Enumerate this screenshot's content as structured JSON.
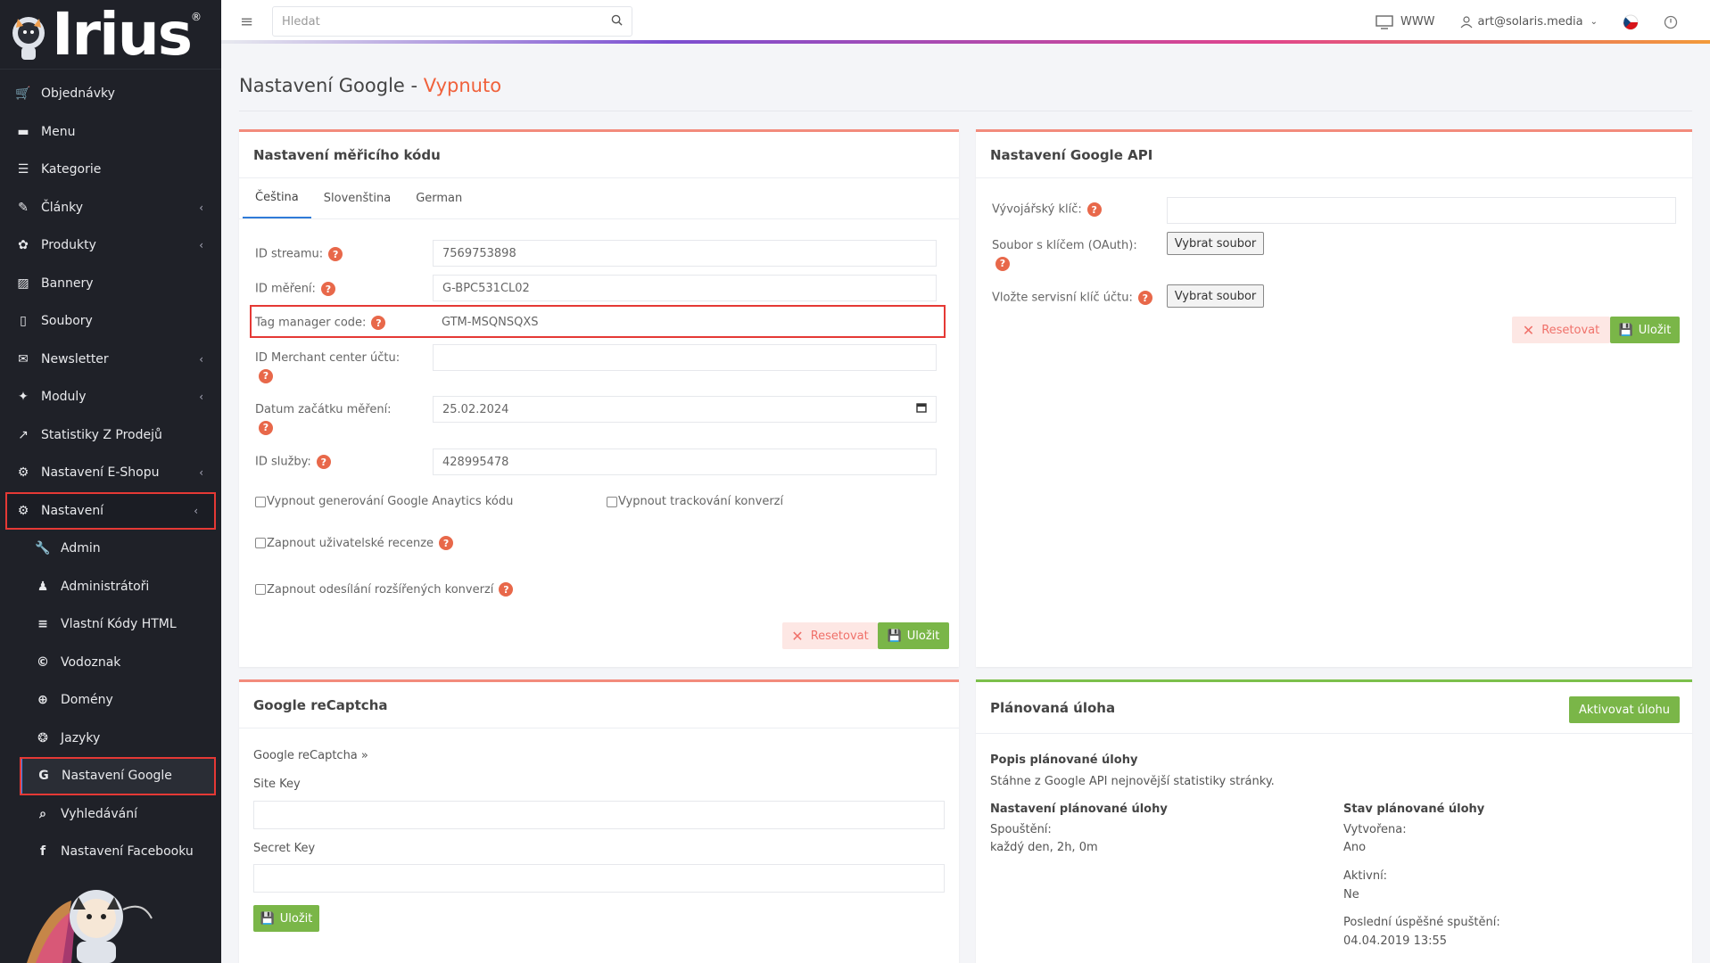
{
  "brand": {
    "logo_text": "Irius"
  },
  "topbar": {
    "search_placeholder": "Hledat",
    "www_label": "WWW",
    "user_email": "art@solaris.media"
  },
  "sidebar": {
    "items": [
      {
        "label": "Objednávky",
        "icon": "cart-icon",
        "chev": false
      },
      {
        "label": "Menu",
        "icon": "folder-icon",
        "chev": false
      },
      {
        "label": "Kategorie",
        "icon": "list-icon",
        "chev": false
      },
      {
        "label": "Články",
        "icon": "pencil-icon",
        "chev": true
      },
      {
        "label": "Produkty",
        "icon": "palette-icon",
        "chev": true
      },
      {
        "label": "Bannery",
        "icon": "image-icon",
        "chev": false
      },
      {
        "label": "Soubory",
        "icon": "file-icon",
        "chev": false
      },
      {
        "label": "Newsletter",
        "icon": "newsletter-icon",
        "chev": true
      },
      {
        "label": "Moduly",
        "icon": "puzzle-icon",
        "chev": true
      },
      {
        "label": "Statistiky Z Prodejů",
        "icon": "chart-icon",
        "chev": false
      },
      {
        "label": "Nastavení E-Shopu",
        "icon": "cogs-icon",
        "chev": true
      },
      {
        "label": "Nastavení",
        "icon": "cogs-icon",
        "chev": true
      }
    ],
    "sub_items": [
      {
        "label": "Admin",
        "icon": "wrench-icon"
      },
      {
        "label": "Administrátoři",
        "icon": "user-icon"
      },
      {
        "label": "Vlastní Kódy HTML",
        "icon": "html-icon"
      },
      {
        "label": "Vodoznak",
        "icon": "copyright-icon"
      },
      {
        "label": "Domény",
        "icon": "globe-icon"
      },
      {
        "label": "Jazyky",
        "icon": "language-icon"
      },
      {
        "label": "Nastavení Google",
        "icon": "google-icon"
      },
      {
        "label": "Vyhledávání",
        "icon": "search-icon"
      },
      {
        "label": "Nastavení Facebooku",
        "icon": "facebook-icon"
      }
    ]
  },
  "page": {
    "title": "Nastavení Google - ",
    "status": "Vypnuto"
  },
  "tracking": {
    "title": "Nastavení měřicího kódu",
    "tabs": [
      "Čeština",
      "Slovenština",
      "German"
    ],
    "fields": {
      "stream_id_label": "ID streamu:",
      "stream_id_value": "7569753898",
      "measure_id_label": "ID měření:",
      "measure_id_value": "G-BPC531CL02",
      "tag_manager_label": "Tag manager code:",
      "tag_manager_value": "GTM-MSQNSQXS",
      "merchant_label": "ID Merchant center účtu:",
      "merchant_value": "",
      "start_date_label": "Datum začátku měření:",
      "start_date_value": "25.02.2024",
      "service_id_label": "ID služby:",
      "service_id_value": "428995478"
    },
    "checkboxes": {
      "disable_ga": "Vypnout generování Google Anaytics kódu",
      "disable_conv": "Vypnout trackování konverzí",
      "enable_reviews": "Zapnout uživatelské recenze",
      "enable_ext_conv": "Zapnout odesílání rozšířených konverzí"
    },
    "reset_label": "Resetovat",
    "save_label": "Uložit"
  },
  "google_api": {
    "title": "Nastavení Google API",
    "dev_key_label": "Vývojářský klíč:",
    "key_file_label": "Soubor s klíčem (OAuth):",
    "service_key_label": "Vložte servisní klíč účtu:",
    "file_button": "Vybrat soubor",
    "reset_label": "Resetovat",
    "save_label": "Uložit"
  },
  "recaptcha": {
    "title": "Google reCaptcha",
    "link": "Google reCaptcha »",
    "site_key_label": "Site Key",
    "secret_key_label": "Secret Key",
    "save_label": "Uložit"
  },
  "scheduled": {
    "title": "Plánovaná úloha",
    "activate_label": "Aktivovat úlohu",
    "desc_title": "Popis plánované úlohy",
    "desc_text": "Stáhne z Google API nejnovější statistiky stránky.",
    "settings_title": "Nastavení plánované úlohy",
    "run_label": "Spouštění:",
    "run_value": "každý den, 2h, 0m",
    "state_title": "Stav plánované úlohy",
    "created_label": "Vytvořena:",
    "created_value": "Ano",
    "active_label": "Aktivní:",
    "active_value": "Ne",
    "last_run_label": "Poslední úspěšné spuštění:",
    "last_run_value": "04.04.2019 13:55"
  },
  "colors": {
    "accent": "#7ab648",
    "danger": "#f0613b",
    "sidebar": "#1f2128"
  }
}
